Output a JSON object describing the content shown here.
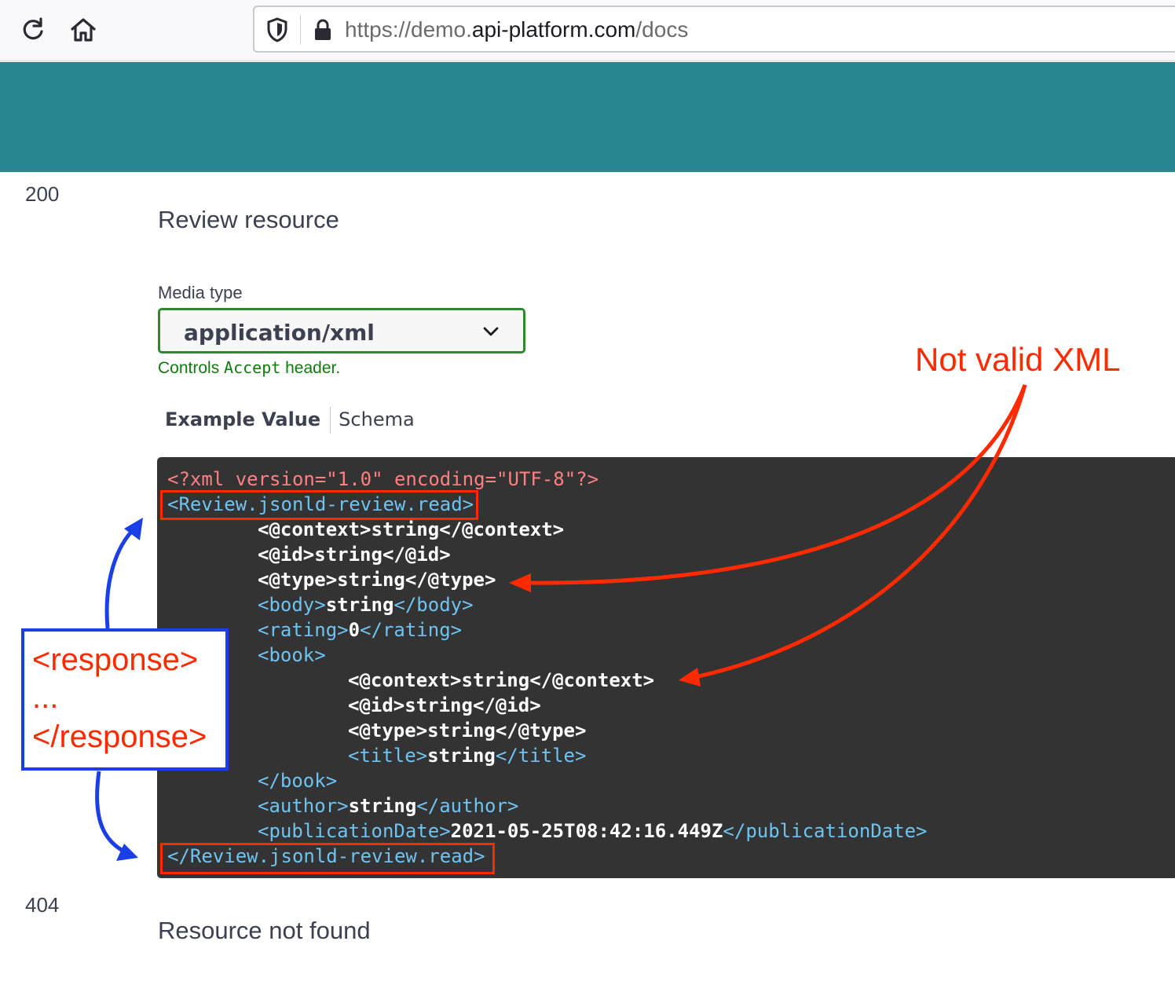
{
  "browser": {
    "url_prefix": "https://demo.",
    "url_host": "api-platform.com",
    "url_path": "/docs",
    "icons": [
      "reload-icon",
      "home-icon",
      "shield-icon",
      "lock-icon"
    ]
  },
  "colors": {
    "banner": "#28868f",
    "select_border": "#2f8a2f",
    "annotation_red": "#ff2a00",
    "annotation_blue": "#1a3fe6",
    "code_bg": "#333333"
  },
  "responses": [
    {
      "code": "200",
      "description": "Review resource"
    },
    {
      "code": "404",
      "description": "Resource not found"
    }
  ],
  "media": {
    "label": "Media type",
    "selected": "application/xml",
    "controls_prefix": "Controls ",
    "controls_code": "Accept",
    "controls_suffix": " header."
  },
  "tabs": {
    "example": "Example Value",
    "schema": "Schema"
  },
  "code": [
    [
      {
        "c": "pi",
        "t": "<?xml version=\"1.0\" encoding=\"UTF-8\"?>"
      }
    ],
    [
      {
        "c": "tag",
        "t": "<Review.jsonld-review.read>"
      }
    ],
    [
      {
        "c": "txt",
        "t": "<@context>string</@context>"
      }
    ],
    [
      {
        "c": "txt",
        "t": "<@id>string</@id>"
      }
    ],
    [
      {
        "c": "txt",
        "t": "<@type>string</@type>"
      }
    ],
    [
      {
        "c": "tag",
        "t": "<body>"
      },
      {
        "c": "txt",
        "t": "string"
      },
      {
        "c": "tag",
        "t": "</body>"
      }
    ],
    [
      {
        "c": "tag",
        "t": "<rating>"
      },
      {
        "c": "txt",
        "t": "0"
      },
      {
        "c": "tag",
        "t": "</rating>"
      }
    ],
    [
      {
        "c": "tag",
        "t": "<book>"
      }
    ],
    [
      {
        "c": "txt",
        "t": "<@context>string</@context>"
      }
    ],
    [
      {
        "c": "txt",
        "t": "<@id>string</@id>"
      }
    ],
    [
      {
        "c": "txt",
        "t": "<@type>string</@type>"
      }
    ],
    [
      {
        "c": "tag",
        "t": "<title>"
      },
      {
        "c": "txt",
        "t": "string"
      },
      {
        "c": "tag",
        "t": "</title>"
      }
    ],
    [
      {
        "c": "tag",
        "t": "</book>"
      }
    ],
    [
      {
        "c": "tag",
        "t": "<author>"
      },
      {
        "c": "txt",
        "t": "string"
      },
      {
        "c": "tag",
        "t": "</author>"
      }
    ],
    [
      {
        "c": "tag",
        "t": "<publicationDate>"
      },
      {
        "c": "txt",
        "t": "2021-05-25T08:42:16.449Z"
      },
      {
        "c": "tag",
        "t": "</publicationDate>"
      }
    ],
    [
      {
        "c": "tag",
        "t": "</Review.jsonld-review.read>"
      }
    ]
  ],
  "annotations": {
    "not_valid": "Not valid XML",
    "response_open": "<response>",
    "response_dots": "...",
    "response_close": "</response>"
  }
}
